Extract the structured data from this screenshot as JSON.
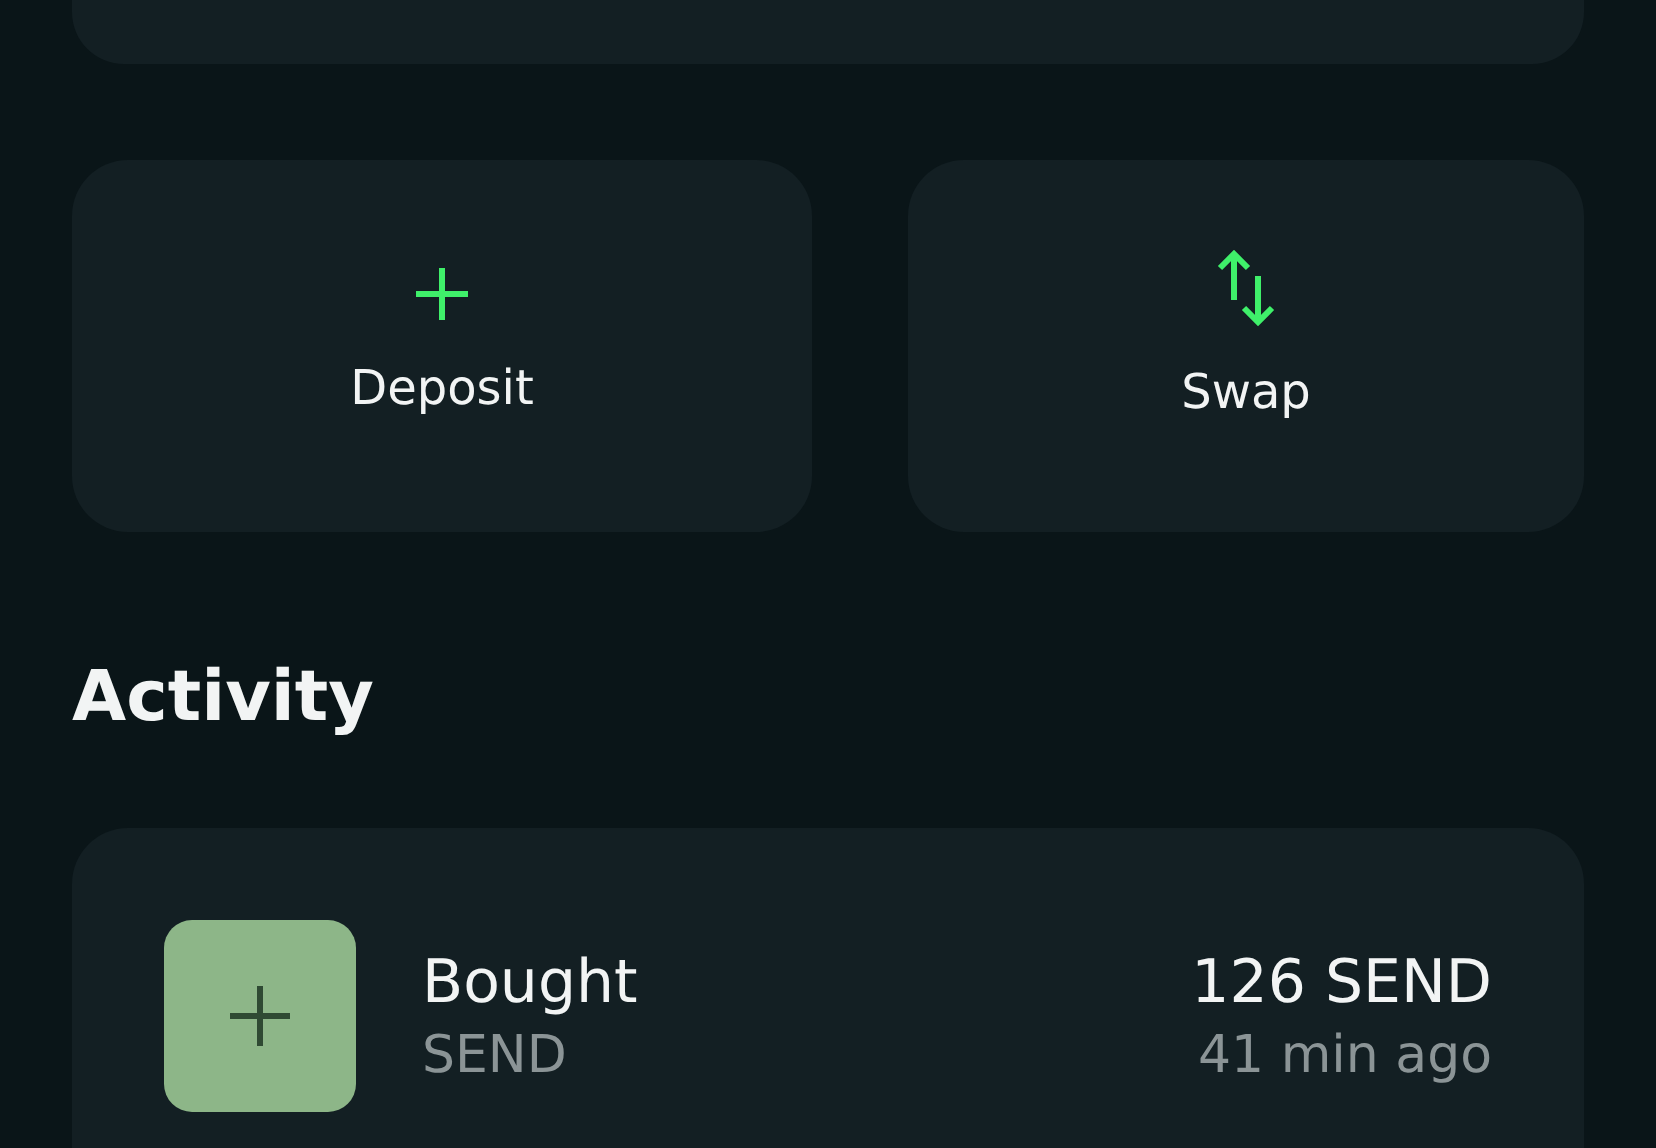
{
  "actions": [
    {
      "label": "Deposit",
      "kind": "deposit"
    },
    {
      "label": "Swap",
      "kind": "swap"
    }
  ],
  "activity": {
    "title": "Activity",
    "items": [
      {
        "kind": "buy",
        "title": "Bought",
        "subtitle": "SEND",
        "amount": "126 SEND",
        "time": "41 min ago"
      }
    ]
  }
}
